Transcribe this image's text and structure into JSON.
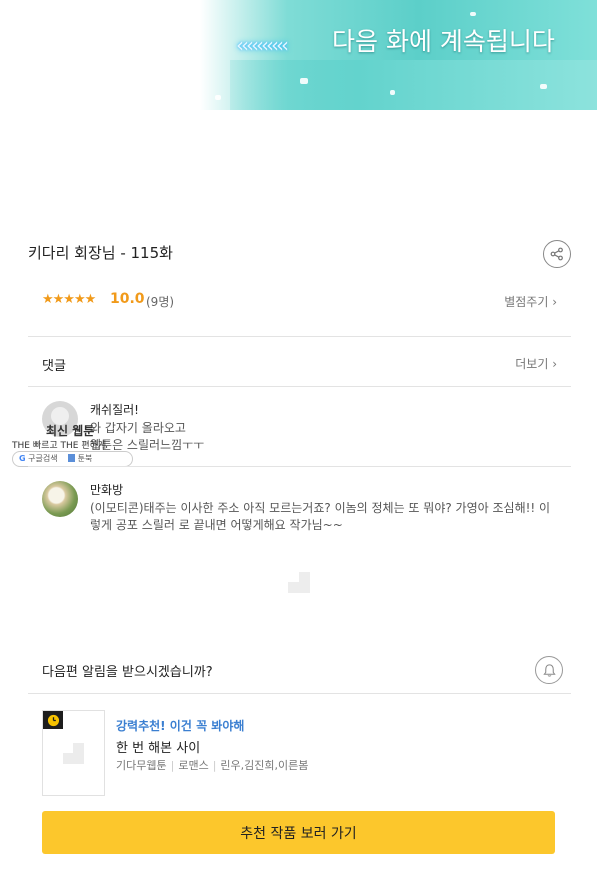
{
  "banner": {
    "arrows": "‹‹‹‹‹‹‹‹‹‹",
    "caption": "다음 화에 계속됩니다"
  },
  "episode": {
    "title": "키다리 회장님 - 115화",
    "share_icon": "share-icon"
  },
  "rating": {
    "stars": "★★★★★",
    "score": "10.0",
    "votes": "(9명)",
    "rate_link": "별점주기 ›"
  },
  "comments": {
    "title": "댓글",
    "more": "더보기 ›",
    "items": [
      {
        "name": "캐쉬질러!",
        "text": "와 갑자기 올라오고\n웹툰은 스릴러느낌ㅜㅜ"
      },
      {
        "name": "만화방",
        "text": "(이모티콘)태주는 이사한 주소 아직 모르는거죠? 이놈의 정체는 또 뭐야? 가영아 조심해!! 이렇게 공포 스릴러 로 끝내면 어떻게해요 작가님~~"
      }
    ]
  },
  "overlay_badge": {
    "title": "최신 웹툰",
    "tagline": "THE 빠르고 THE 편하게",
    "google": "G",
    "google_label": "구글검색",
    "book_label": "툰북"
  },
  "notify": {
    "text": "다음편 알림을 받으시겠습니까?",
    "bell_icon": "bell-icon"
  },
  "recommendation": {
    "tag": "강력추천! 이건 꼭 봐야해",
    "title": "한 번 해본 사이",
    "meta": [
      "기다무웹툰",
      "로맨스",
      "린우,김진희,이른봄"
    ]
  },
  "cta": {
    "label": "추천 작품 보러 가기"
  },
  "colors": {
    "accent_orange": "#f19a1a",
    "cta_yellow": "#fcc72c",
    "link_blue": "#3b7fd1",
    "banner_teal": "#5ccfc9"
  }
}
